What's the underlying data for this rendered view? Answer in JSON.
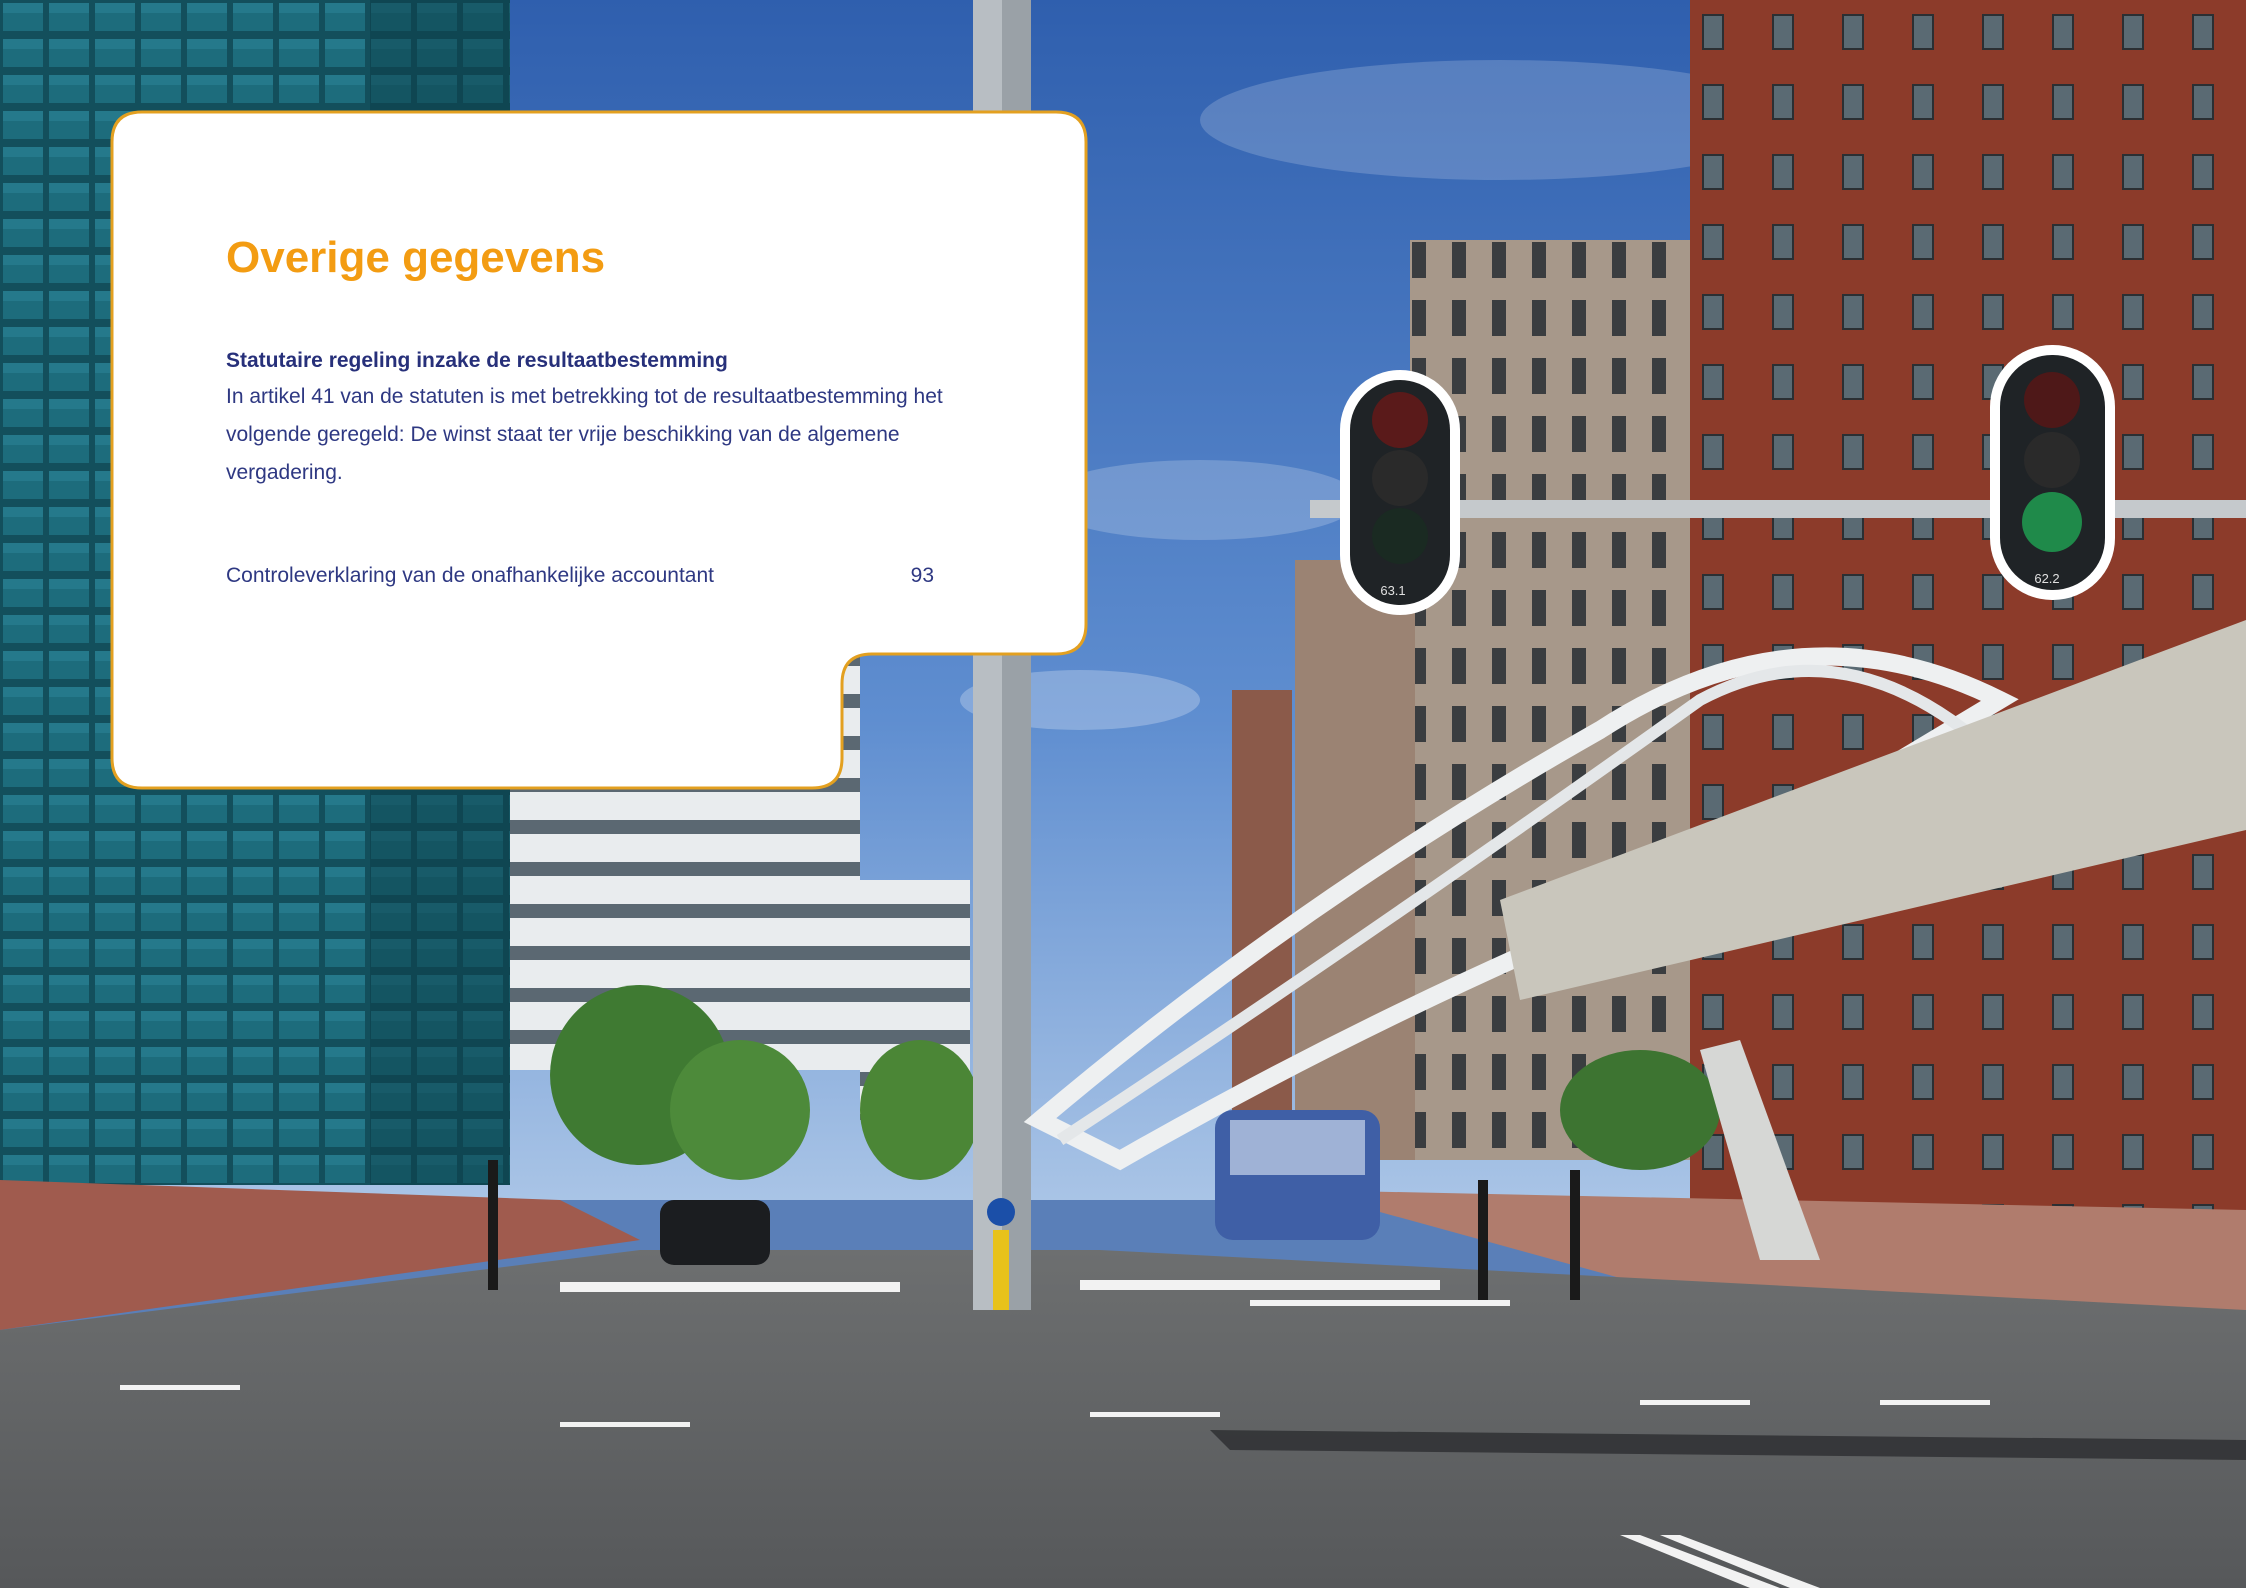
{
  "section": {
    "title": "Overige gegevens",
    "subheading": "Statutaire regeling inzake de resultaatbestemming",
    "paragraph": "In artikel 41 van de statuten is met betrekking tot de resultaatbestemming het volgende geregeld: De winst staat ter vrije beschikking van de algemene vergadering."
  },
  "toc": {
    "label": "Controleverklaring van de onafhankelijke accountant",
    "page": "93"
  },
  "traffic_lights": {
    "left_label": "63.1",
    "right_label": "62.2"
  },
  "colors": {
    "accent": "#f39c12",
    "text": "#2e3882",
    "card_border": "#e3a020"
  }
}
